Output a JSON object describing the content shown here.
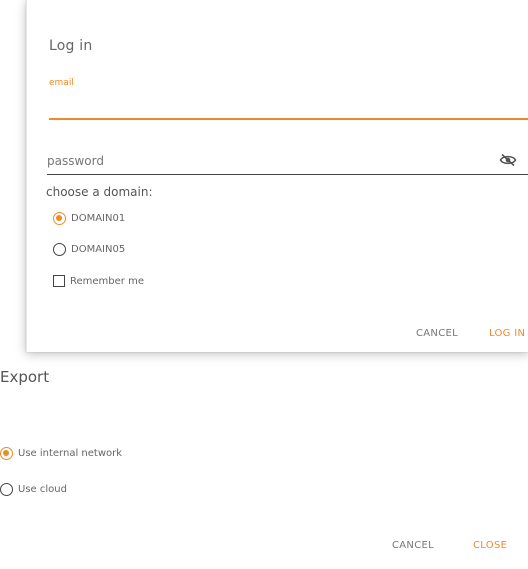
{
  "login": {
    "title": "Log in",
    "email_label": "email",
    "password_placeholder": "password",
    "domain_label": "choose a domain:",
    "options": [
      {
        "label": "DOMAIN01",
        "type": "radio",
        "checked": true
      },
      {
        "label": "DOMAIN05",
        "type": "radio",
        "checked": false
      },
      {
        "label": "Remember me",
        "type": "checkbox",
        "checked": false
      }
    ],
    "cancel_label": "CANCEL",
    "login_label": "LOG IN"
  },
  "export": {
    "title": "Export",
    "options": [
      {
        "label": "Use internal network",
        "checked": true
      },
      {
        "label": "Use cloud",
        "checked": false
      }
    ],
    "cancel_label": "CANCEL",
    "accent_label": "CLOSE"
  },
  "colors": {
    "accent": "#f08a24",
    "text": "#555555"
  },
  "icons": {
    "password_toggle": "eye-slash-icon"
  }
}
